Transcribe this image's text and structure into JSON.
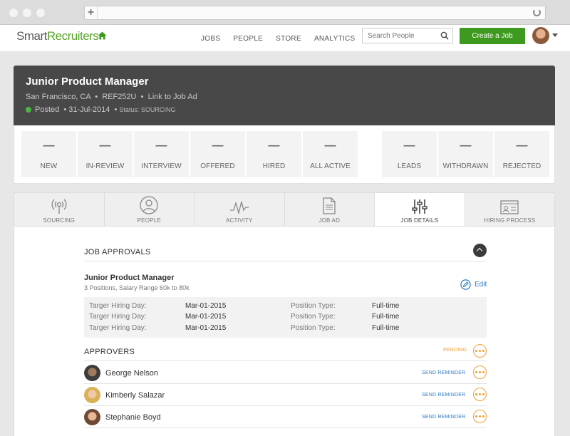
{
  "nav": {
    "logo_part1": "Smart",
    "logo_part2": "Recruiters",
    "links": [
      "JOBS",
      "PEOPLE",
      "STORE",
      "ANALYTICS"
    ],
    "search_placeholder": "Search People",
    "create_label": "Create a Job"
  },
  "job": {
    "title": "Junior Product Manager",
    "location": "San Francisco, CA",
    "ref": "REF252U",
    "link_label": "Link to Job Ad",
    "posted": "Posted",
    "date": "31-Jul-2014",
    "status": "Status: SOURCING"
  },
  "pipeline": {
    "stages": [
      {
        "label": "NEW",
        "value": "—"
      },
      {
        "label": "IN-REVIEW",
        "value": "—"
      },
      {
        "label": "INTERVIEW",
        "value": "—"
      },
      {
        "label": "OFFERED",
        "value": "—"
      },
      {
        "label": "HIRED",
        "value": "—"
      },
      {
        "label": "ALL ACTIVE",
        "value": "—"
      },
      {
        "label": "LEADS",
        "value": "—"
      },
      {
        "label": "WITHDRAWN",
        "value": "—"
      },
      {
        "label": "REJECTED",
        "value": "—"
      }
    ]
  },
  "tabs": [
    {
      "label": "SOURCING",
      "icon": "broadcast-icon"
    },
    {
      "label": "PEOPLE",
      "icon": "person-icon"
    },
    {
      "label": "ACTIVITY",
      "icon": "activity-icon"
    },
    {
      "label": "JOB AD",
      "icon": "document-icon"
    },
    {
      "label": "JOB DETAILS",
      "icon": "sliders-icon",
      "active": true
    },
    {
      "label": "HIRING PROCESS",
      "icon": "id-card-icon"
    }
  ],
  "approvals": {
    "section_title": "JOB APPROVALS",
    "title": "Junior Product Manager",
    "subtitle": "3 Positions, Salary Range 60k to 80k",
    "edit_label": "Edit",
    "rows": [
      {
        "k1": "Targer Hiring Day:",
        "v1": "Mar-01-2015",
        "k2": "Position Type:",
        "v2": "Full-time"
      },
      {
        "k1": "Targer Hiring Day:",
        "v1": "Mar-01-2015",
        "k2": "Position Type:",
        "v2": "Full-time"
      },
      {
        "k1": "Targer Hiring Day:",
        "v1": "Mar-01-2015",
        "k2": "Position Type:",
        "v2": "Full-time"
      }
    ]
  },
  "approvers": {
    "section_title": "APPROVERS",
    "status": "PENDING",
    "list": [
      {
        "name": "George Nelson",
        "action": "SEND REMINDER"
      },
      {
        "name": "Kimberly Salazar",
        "action": "SEND REMINDER"
      },
      {
        "name": "Stephanie Boyd",
        "action": "SEND REMINDER"
      }
    ]
  },
  "colors": {
    "brand_green": "#3e9a1e",
    "header_dark": "#484848",
    "link_blue": "#2e7bbf",
    "pending_orange": "#f0a030"
  }
}
